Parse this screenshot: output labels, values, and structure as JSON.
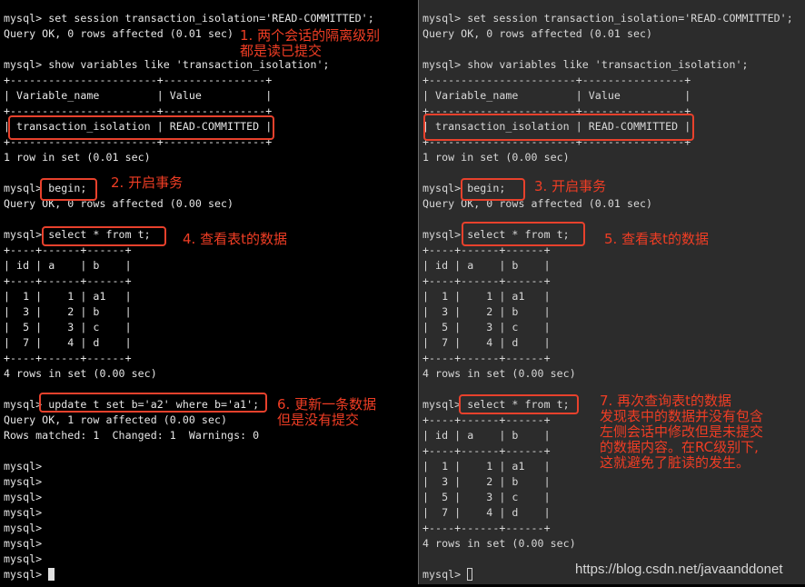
{
  "left_terminal": {
    "lines": [
      "mysql> set session transaction_isolation='READ-COMMITTED';",
      "Query OK, 0 rows affected (0.01 sec)",
      "",
      "mysql> show variables like 'transaction_isolation';",
      "+-----------------------+----------------+",
      "| Variable_name         | Value          |",
      "+-----------------------+----------------+",
      "| transaction_isolation | READ-COMMITTED |",
      "+-----------------------+----------------+",
      "1 row in set (0.01 sec)",
      "",
      "mysql> begin;",
      "Query OK, 0 rows affected (0.00 sec)",
      "",
      "mysql> select * from t;",
      "+----+------+------+",
      "| id | a    | b    |",
      "+----+------+------+",
      "|  1 |    1 | a1   |",
      "|  3 |    2 | b    |",
      "|  5 |    3 | c    |",
      "|  7 |    4 | d    |",
      "+----+------+------+",
      "4 rows in set (0.00 sec)",
      "",
      "mysql> update t set b='a2' where b='a1';",
      "Query OK, 1 row affected (0.00 sec)",
      "Rows matched: 1  Changed: 1  Warnings: 0",
      "",
      "mysql> ",
      "mysql> ",
      "mysql> ",
      "mysql> ",
      "mysql> ",
      "mysql> ",
      "mysql> ",
      "mysql> "
    ],
    "annotations": [
      {
        "step": "1",
        "text": "1. 两个会话的隔离级别\n都是读已提交"
      },
      {
        "step": "2",
        "text": "2. 开启事务"
      },
      {
        "step": "4",
        "text": "4. 查看表t的数据"
      },
      {
        "step": "6",
        "text": "6. 更新一条数据\n但是没有提交"
      }
    ]
  },
  "right_terminal": {
    "lines": [
      "mysql> set session transaction_isolation='READ-COMMITTED';",
      "Query OK, 0 rows affected (0.01 sec)",
      "",
      "mysql> show variables like 'transaction_isolation';",
      "+-----------------------+----------------+",
      "| Variable_name         | Value          |",
      "+-----------------------+----------------+",
      "| transaction_isolation | READ-COMMITTED |",
      "+-----------------------+----------------+",
      "1 row in set (0.00 sec)",
      "",
      "mysql> begin;",
      "Query OK, 0 rows affected (0.01 sec)",
      "",
      "mysql> select * from t;",
      "+----+------+------+",
      "| id | a    | b    |",
      "+----+------+------+",
      "|  1 |    1 | a1   |",
      "|  3 |    2 | b    |",
      "|  5 |    3 | c    |",
      "|  7 |    4 | d    |",
      "+----+------+------+",
      "4 rows in set (0.00 sec)",
      "",
      "mysql> select * from t;",
      "+----+------+------+",
      "| id | a    | b    |",
      "+----+------+------+",
      "|  1 |    1 | a1   |",
      "|  3 |    2 | b    |",
      "|  5 |    3 | c    |",
      "|  7 |    4 | d    |",
      "+----+------+------+",
      "4 rows in set (0.00 sec)",
      "",
      "mysql> "
    ],
    "annotations": [
      {
        "step": "3",
        "text": "3. 开启事务"
      },
      {
        "step": "5",
        "text": "5. 查看表t的数据"
      },
      {
        "step": "7",
        "text": "7. 再次查询表t的数据\n发现表中的数据并没有包含\n左侧会话中修改但是未提交\n的数据内容。在RC级别下,\n这就避免了脏读的发生。"
      }
    ]
  },
  "watermark": "https://blog.csdn.net/javaanddonet",
  "colors": {
    "left_background": "#000000",
    "right_background": "#2c2c2c",
    "terminal_text": "#e6e6e6",
    "annotation_red": "#ef3d24"
  }
}
